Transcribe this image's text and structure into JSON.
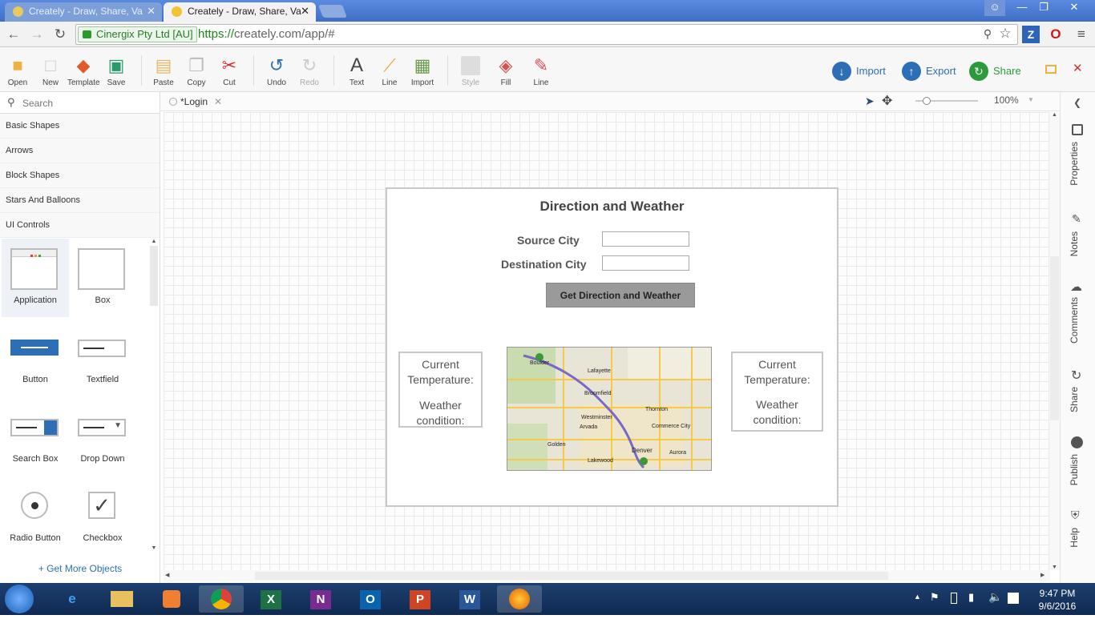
{
  "browser": {
    "tabs": [
      {
        "title": "Creately - Draw, Share, Va",
        "active": false
      },
      {
        "title": "Creately - Draw, Share, Va",
        "active": true
      }
    ],
    "ssl_label": "Cinergix Pty Ltd [AU]",
    "url_scheme": "https://",
    "url_rest": "creately.com/app/#"
  },
  "toolbar": {
    "buttons": [
      {
        "label": "Open",
        "icon": "folder-icon"
      },
      {
        "label": "New",
        "icon": "new-document-icon"
      },
      {
        "label": "Template",
        "icon": "template-stack-icon"
      },
      {
        "label": "Save",
        "icon": "save-disk-icon"
      },
      {
        "label": "Paste",
        "icon": "paste-icon"
      },
      {
        "label": "Copy",
        "icon": "copy-icon"
      },
      {
        "label": "Cut",
        "icon": "scissors-icon"
      },
      {
        "label": "Undo",
        "icon": "undo-icon"
      },
      {
        "label": "Redo",
        "icon": "redo-icon"
      },
      {
        "label": "Text",
        "icon": "text-icon"
      },
      {
        "label": "Line",
        "icon": "line-icon"
      },
      {
        "label": "Import",
        "icon": "image-import-icon"
      },
      {
        "label": "Style",
        "icon": "style-icon"
      },
      {
        "label": "Fill",
        "icon": "fill-bucket-icon"
      },
      {
        "label": "Line",
        "icon": "pen-line-icon"
      }
    ],
    "import_label": "Import",
    "export_label": "Export",
    "share_label": "Share"
  },
  "left_panel": {
    "search_placeholder": "Search",
    "categories": [
      "Basic Shapes",
      "Arrows",
      "Block Shapes",
      "Stars And Balloons",
      "UI Controls"
    ],
    "shapes": [
      "Application",
      "Box",
      "Button",
      "Textfield",
      "Search Box",
      "Drop Down",
      "Radio Button",
      "Checkbox"
    ],
    "get_more": "+ Get More Objects"
  },
  "canvas": {
    "doc_tab": "*Login",
    "zoom": "100%"
  },
  "mockup": {
    "title": "Direction and Weather",
    "source_label": "Source City",
    "destination_label": "Destination City",
    "button_label": "Get Direction and Weather",
    "left_box": {
      "line1": "Current",
      "line2": "Temperature:",
      "line3": "Weather",
      "line4": "condition:"
    },
    "right_box": {
      "line1": "Current",
      "line2": "Temperature:",
      "line3": "Weather",
      "line4": "condition:"
    },
    "map_labels": [
      "Boulder",
      "Lafayette",
      "Broomfield",
      "Thornton",
      "Westminster",
      "Arvada",
      "Golden",
      "Lakewood",
      "Denver",
      "Aurora",
      "Commerce City"
    ]
  },
  "right_rail": [
    "Properties",
    "Notes",
    "Comments",
    "Share",
    "Publish",
    "Help"
  ],
  "taskbar": {
    "time": "9:47 PM",
    "date": "9/6/2016"
  }
}
